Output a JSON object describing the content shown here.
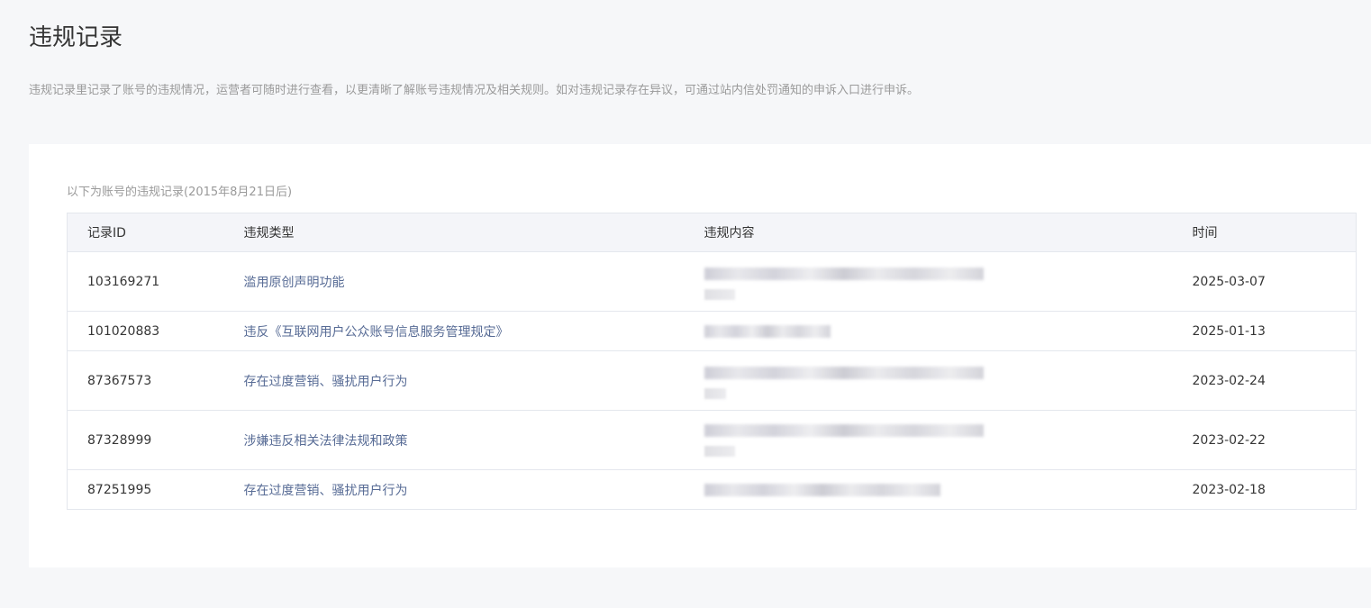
{
  "page": {
    "title": "违规记录",
    "description": "违规记录里记录了账号的违规情况，运营者可随时进行查看，以更清晰了解账号违规情况及相关规则。如对违规记录存在异议，可通过站内信处罚通知的申诉入口进行申诉。"
  },
  "records": {
    "subtitle": "以下为账号的违规记录(2015年8月21日后)",
    "columns": {
      "id": "记录ID",
      "type": "违规类型",
      "content": "违规内容",
      "time": "时间"
    },
    "rows": [
      {
        "id": "103169271",
        "type": "滥用原创声明功能",
        "content": "",
        "time": "2025-03-07"
      },
      {
        "id": "101020883",
        "type": "违反《互联网用户公众账号信息服务管理规定》",
        "content": "",
        "time": "2025-01-13"
      },
      {
        "id": "87367573",
        "type": "存在过度营销、骚扰用户行为",
        "content": "",
        "time": "2023-02-24"
      },
      {
        "id": "87328999",
        "type": "涉嫌违反相关法律法规和政策",
        "content": "",
        "time": "2023-02-22"
      },
      {
        "id": "87251995",
        "type": "存在过度营销、骚扰用户行为",
        "content": "",
        "time": "2023-02-18"
      }
    ]
  },
  "colors": {
    "page_bg": "#f6f7f9",
    "card_bg": "#ffffff",
    "header_bg": "#f4f5f9",
    "link_text": "#576b95",
    "muted_text": "#9a9a9a",
    "border": "#e4e7ed"
  }
}
